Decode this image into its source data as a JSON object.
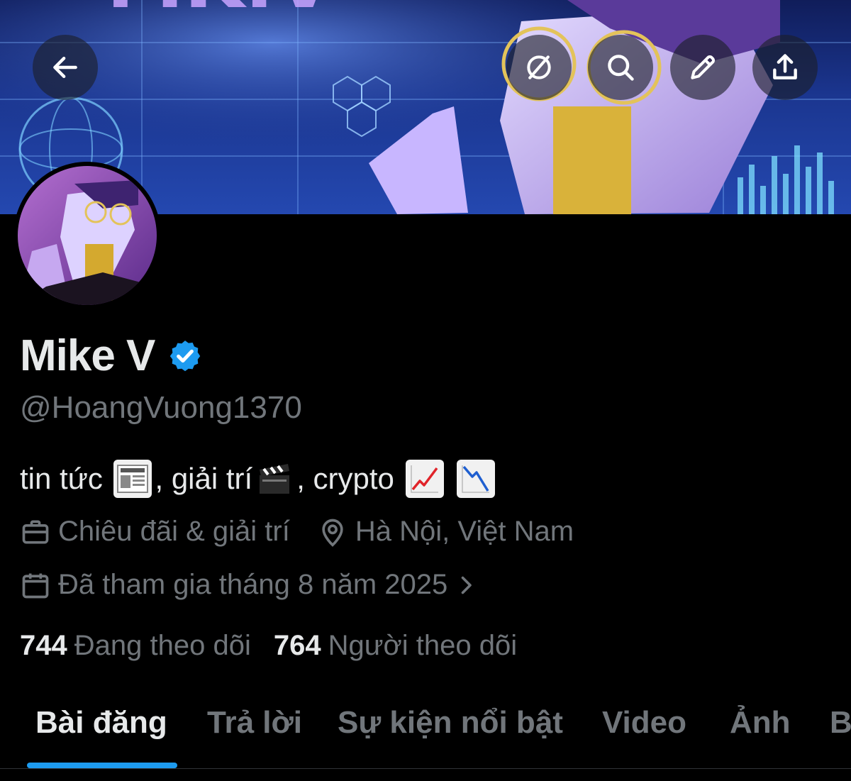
{
  "header": {
    "back_icon": "arrow-left-icon",
    "actions": [
      "grok-icon",
      "search-icon",
      "pencil-icon",
      "share-icon"
    ]
  },
  "banner": {
    "text": "MK.V"
  },
  "profile": {
    "name": "Mike V",
    "verified_color": "#1d9bf0",
    "handle": "@HoangVuong1370",
    "bio": {
      "part1": "tin tức ",
      "part2": ", giải trí",
      "part3": ", crypto "
    },
    "category": "Chiêu đãi & giải trí",
    "location": "Hà Nội, Việt Nam",
    "joined": "Đã tham gia tháng 8 năm 2025"
  },
  "stats": {
    "following_count": "744",
    "following_label": "Đang theo dõi",
    "followers_count": "764",
    "followers_label": "Người theo dõi"
  },
  "tabs": [
    {
      "label": "Bài đăng",
      "active": true
    },
    {
      "label": "Trả lời",
      "active": false
    },
    {
      "label": "Sự kiện nổi bật",
      "active": false
    },
    {
      "label": "Video",
      "active": false
    },
    {
      "label": "Ảnh",
      "active": false
    },
    {
      "label": "B",
      "active": false
    }
  ],
  "colors": {
    "accent": "#1d9bf0",
    "secondary_text": "#71767b"
  }
}
